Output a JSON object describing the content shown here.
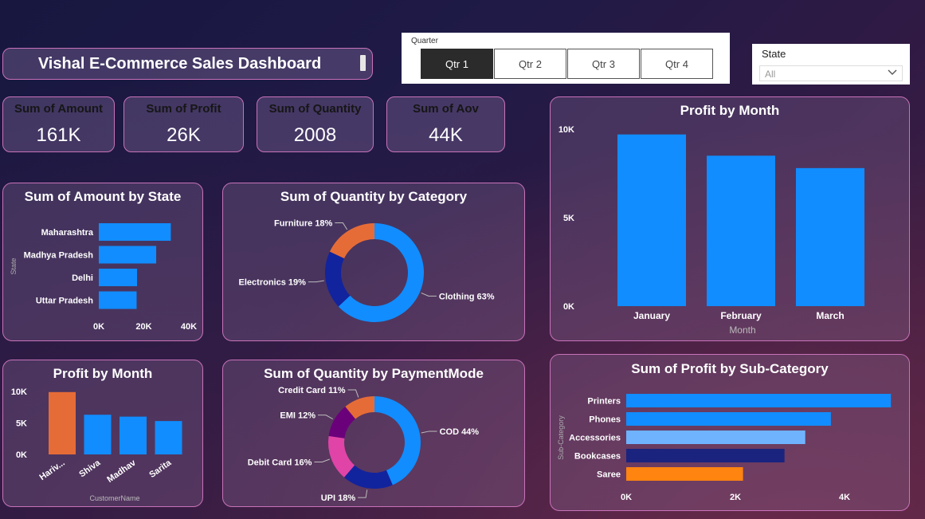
{
  "header": {
    "title": "Vishal E-Commerce Sales Dashboard"
  },
  "quarter_slicer": {
    "label": "Quarter",
    "options": [
      "Qtr 1",
      "Qtr 2",
      "Qtr 3",
      "Qtr 4"
    ],
    "selected": "Qtr 1"
  },
  "state_slicer": {
    "label": "State",
    "value": "All"
  },
  "kpis": [
    {
      "label": "Sum of Amount",
      "value": "161K"
    },
    {
      "label": "Sum of Profit",
      "value": "26K"
    },
    {
      "label": "Sum of Quantity",
      "value": "2008"
    },
    {
      "label": "Sum of Aov",
      "value": "44K"
    }
  ],
  "colors": {
    "blue": "#118dff",
    "orange": "#e66c37",
    "navy": "#12239e",
    "light_blue": "#6fb3ff",
    "dark_navy": "#1a237e",
    "purple": "#6b007b",
    "pink": "#e044a7",
    "bright_orange": "#ff8410"
  },
  "chart_data": [
    {
      "id": "amount_by_state",
      "type": "bar",
      "orientation": "horizontal",
      "title": "Sum of Amount by State",
      "ylabel": "State",
      "categories": [
        "Maharashtra",
        "Madhya Pradesh",
        "Delhi",
        "Uttar Pradesh"
      ],
      "values": [
        32000,
        25500,
        17000,
        16800
      ],
      "xlim": [
        0,
        40000
      ],
      "xticks": [
        "0K",
        "20K",
        "40K"
      ],
      "color": "#118dff"
    },
    {
      "id": "quantity_by_category",
      "type": "pie",
      "variant": "donut",
      "title": "Sum of Quantity by Category",
      "slices": [
        {
          "label": "Clothing 63%",
          "value": 63,
          "color": "#118dff"
        },
        {
          "label": "Electronics 19%",
          "value": 19,
          "color": "#12239e"
        },
        {
          "label": "Furniture 18%",
          "value": 18,
          "color": "#e66c37"
        }
      ]
    },
    {
      "id": "profit_by_month_large",
      "type": "bar",
      "title": "Profit by Month",
      "xlabel": "Month",
      "categories": [
        "January",
        "February",
        "March"
      ],
      "values": [
        9700,
        8500,
        7800
      ],
      "ylim": [
        0,
        10000
      ],
      "yticks": [
        "0K",
        "5K",
        "10K"
      ],
      "color": "#118dff"
    },
    {
      "id": "profit_by_customer",
      "type": "bar",
      "title": "Profit by Month",
      "xlabel": "CustomerName",
      "categories": [
        "Hariv...",
        "Shiva",
        "Madhav",
        "Sarita"
      ],
      "values": [
        9900,
        6300,
        6000,
        5300
      ],
      "ylim": [
        0,
        10000
      ],
      "yticks": [
        "0K",
        "5K",
        "10K"
      ],
      "colors": [
        "#e66c37",
        "#118dff",
        "#118dff",
        "#118dff"
      ]
    },
    {
      "id": "quantity_by_paymentmode",
      "type": "pie",
      "variant": "donut",
      "title": "Sum of Quantity by PaymentMode",
      "slices": [
        {
          "label": "COD 44%",
          "value": 44,
          "color": "#118dff"
        },
        {
          "label": "UPI 18%",
          "value": 18,
          "color": "#12239e"
        },
        {
          "label": "Debit Card 16%",
          "value": 16,
          "color": "#e044a7"
        },
        {
          "label": "EMI 12%",
          "value": 12,
          "color": "#6b007b"
        },
        {
          "label": "Credit Card 11%",
          "value": 11,
          "color": "#e66c37"
        }
      ]
    },
    {
      "id": "profit_by_subcategory",
      "type": "bar",
      "orientation": "horizontal",
      "title": "Sum of Profit by Sub-Category",
      "ylabel": "Sub-Category",
      "categories": [
        "Printers",
        "Phones",
        "Accessories",
        "Bookcases",
        "Saree"
      ],
      "values": [
        4850,
        3750,
        3280,
        2900,
        2140
      ],
      "xlim": [
        0,
        4000
      ],
      "xticks": [
        "0K",
        "2K",
        "4K"
      ],
      "colors": [
        "#118dff",
        "#118dff",
        "#6fb3ff",
        "#1a237e",
        "#ff8410"
      ]
    }
  ]
}
